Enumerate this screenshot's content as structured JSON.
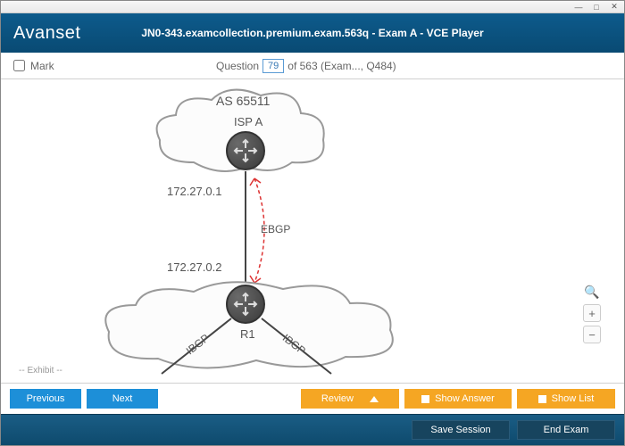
{
  "window": {
    "title": "JN0-343.examcollection.premium.exam.563q - Exam A - VCE Player",
    "logo_text": "Avanset"
  },
  "subbar": {
    "mark_label": "Mark",
    "question_word": "Question",
    "current_q": "79",
    "total_text": "of 563 (Exam..., Q484)"
  },
  "diagram": {
    "as_label": "AS 65511",
    "isp_label": "ISP A",
    "ip_top": "172.27.0.1",
    "ip_bottom": "172.27.0.2",
    "ebgp": "EBGP",
    "r1": "R1",
    "ibgp_left": "IBGP",
    "ibgp_right": "IBGP"
  },
  "exhibit_tag": "-- Exhibit --",
  "buttons": {
    "previous": "Previous",
    "next": "Next",
    "review": "Review",
    "show_answer": "Show Answer",
    "show_list": "Show List",
    "save_session": "Save Session",
    "end_exam": "End Exam"
  }
}
